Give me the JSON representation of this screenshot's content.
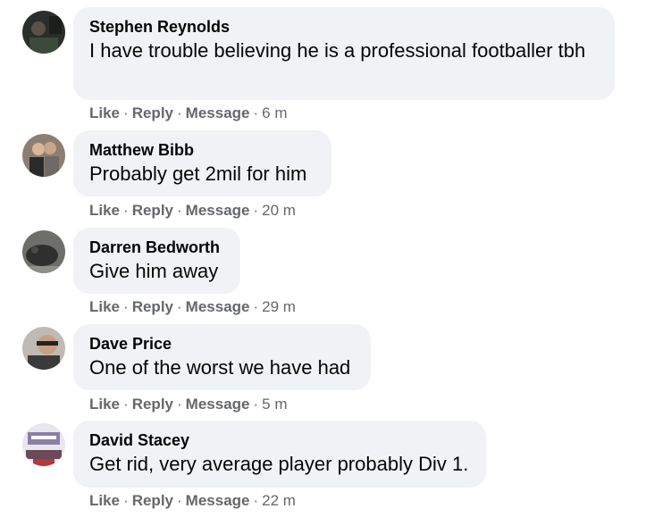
{
  "comments": [
    {
      "author": "Stephen Reynolds",
      "text": "I have trouble believing he is a professional footballer tbh",
      "like": "Like",
      "reply": "Reply",
      "message": "Message",
      "time": "6 m"
    },
    {
      "author": "Matthew Bibb",
      "text": "Probably get 2mil for him",
      "like": "Like",
      "reply": "Reply",
      "message": "Message",
      "time": "20 m"
    },
    {
      "author": "Darren Bedworth",
      "text": "Give him away",
      "like": "Like",
      "reply": "Reply",
      "message": "Message",
      "time": "29 m"
    },
    {
      "author": "Dave Price",
      "text": "One of the worst we have had",
      "like": "Like",
      "reply": "Reply",
      "message": "Message",
      "time": "5 m"
    },
    {
      "author": "David Stacey",
      "text": "Get rid, very average player probably Div 1.",
      "like": "Like",
      "reply": "Reply",
      "message": "Message",
      "time": "22 m"
    }
  ],
  "separator": "·",
  "colors": {
    "bubble": "#f0f2f5",
    "meta": "#65676b",
    "text": "#050505"
  }
}
